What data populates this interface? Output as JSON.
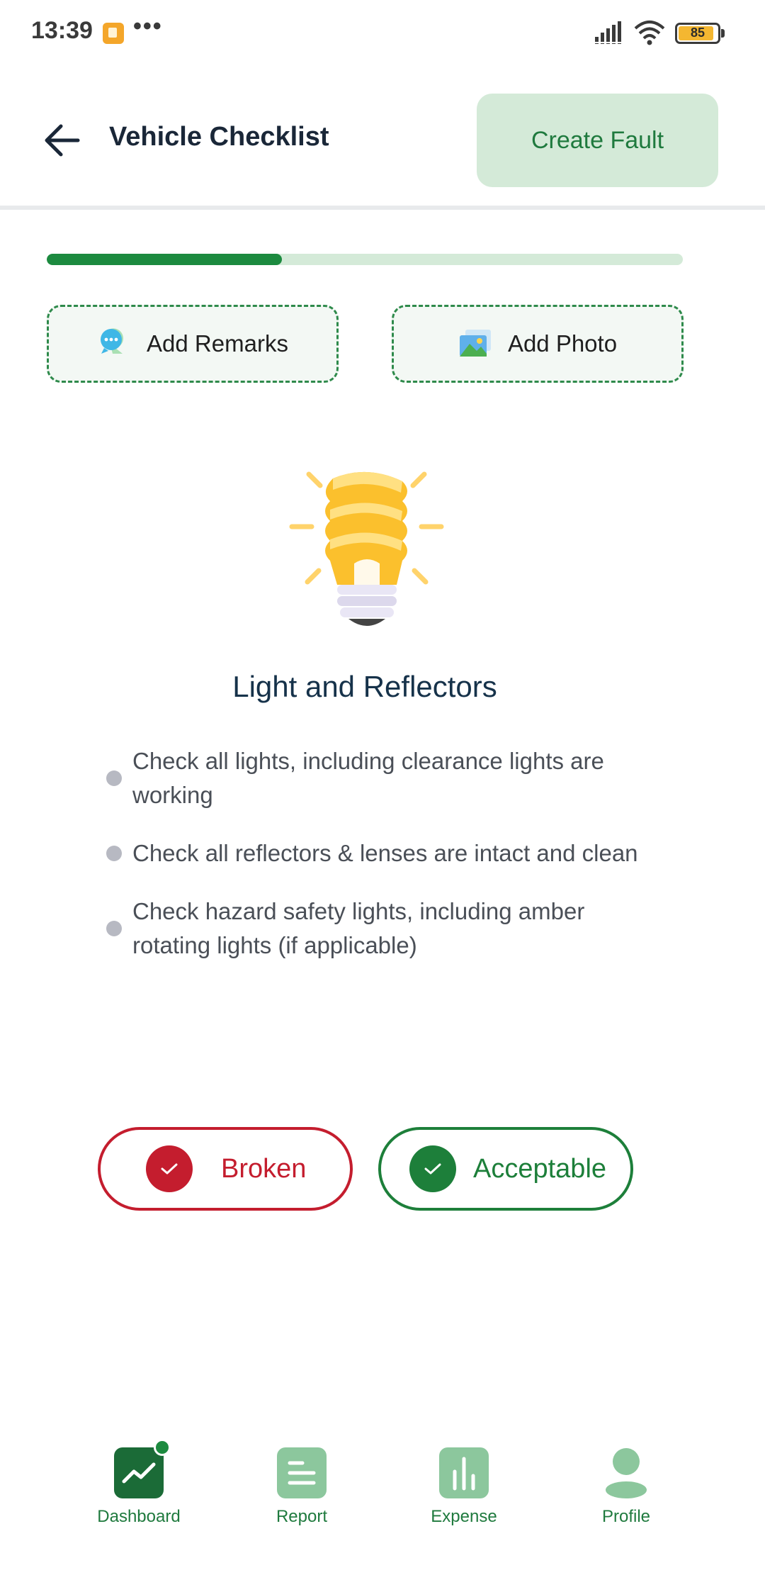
{
  "status_bar": {
    "time": "13:39",
    "battery": "85"
  },
  "header": {
    "title": "Vehicle Checklist",
    "create_fault_label": "Create Fault"
  },
  "progress": {
    "value": 0.37
  },
  "actions": {
    "remarks_label": "Add Remarks",
    "photo_label": "Add Photo"
  },
  "item": {
    "title": "Light and Reflectors",
    "checks": [
      "Check all lights, including clearance lights are working",
      "Check all reflectors & lenses are intact and clean",
      "Check hazard safety lights, including amber rotating lights (if applicable)"
    ]
  },
  "result": {
    "broken_label": "Broken",
    "acceptable_label": "Acceptable"
  },
  "nav": [
    {
      "label": "Dashboard",
      "icon": "dashboard-icon",
      "active": true
    },
    {
      "label": "Report",
      "icon": "report-icon"
    },
    {
      "label": "Expense",
      "icon": "expense-icon"
    },
    {
      "label": "Profile",
      "icon": "profile-icon"
    }
  ],
  "colors": {
    "brand_green": "#1c8a3f",
    "danger_red": "#c41d2e",
    "light_green": "#d4ead8"
  }
}
